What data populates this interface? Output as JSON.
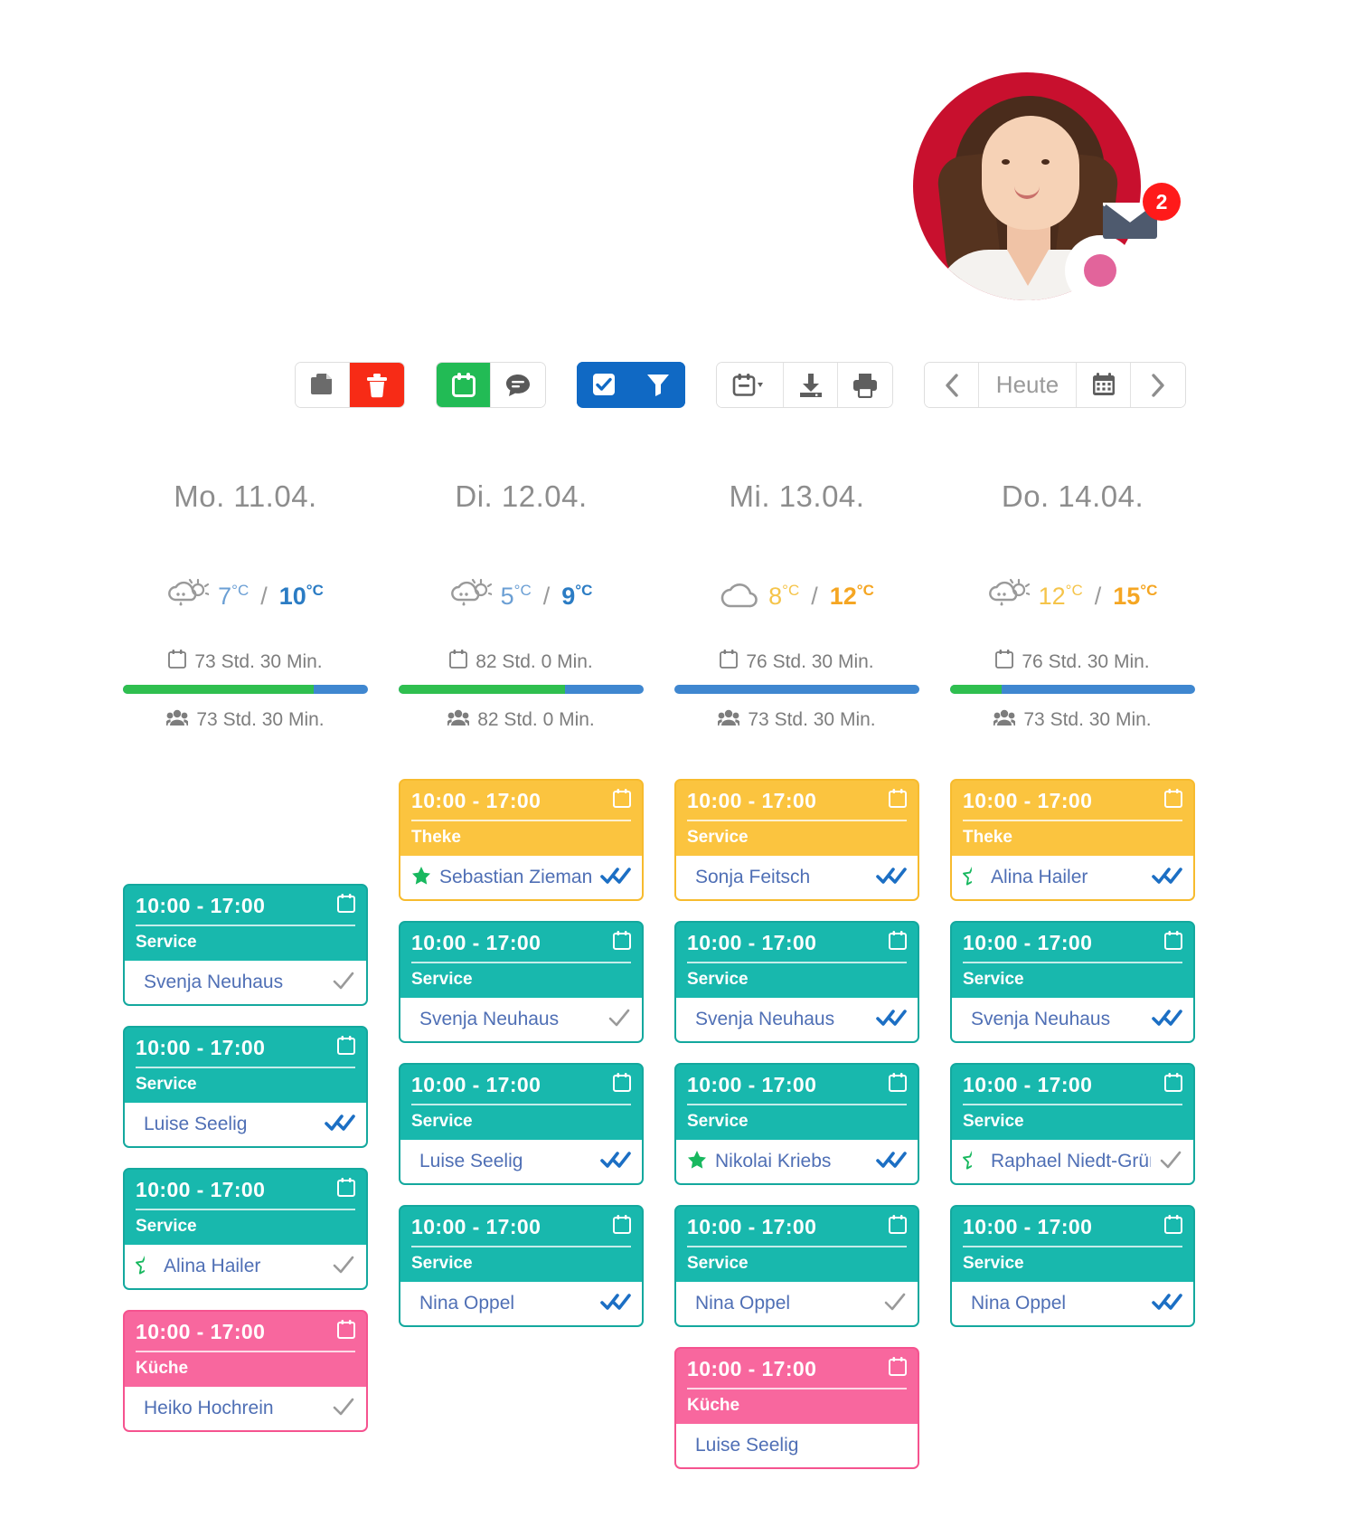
{
  "avatar": {
    "status_color": "#e2649b",
    "ring_color": "#c8102e",
    "name_alt": "user-avatar"
  },
  "mail": {
    "badge_count": "2",
    "icon": "mail-icon"
  },
  "toolbar": {
    "groups": [
      {
        "name": "edit-group",
        "buttons": [
          {
            "name": "copy-button",
            "icon": "copy-icon",
            "style": "plain"
          },
          {
            "name": "delete-button",
            "icon": "trash-icon",
            "style": "red"
          }
        ]
      },
      {
        "name": "create-group",
        "buttons": [
          {
            "name": "add-shift-button",
            "icon": "calendar-plus-icon",
            "style": "green"
          },
          {
            "name": "comment-button",
            "icon": "chat-bubble-icon",
            "style": "plain"
          }
        ]
      },
      {
        "name": "select-filter-group",
        "buttons": [
          {
            "name": "select-all-button",
            "icon": "checkbox-icon",
            "style": "blue"
          },
          {
            "name": "filter-button",
            "icon": "funnel-icon",
            "style": "blue"
          }
        ]
      },
      {
        "name": "view-export-group",
        "buttons": [
          {
            "name": "view-mode-button",
            "icon": "calendar-dropdown-icon",
            "style": "plain"
          },
          {
            "name": "download-button",
            "icon": "download-icon",
            "style": "plain"
          },
          {
            "name": "print-button",
            "icon": "printer-icon",
            "style": "plain"
          }
        ]
      },
      {
        "name": "navigation-group",
        "buttons": [
          {
            "name": "previous-period-button",
            "icon": "chevron-left-icon",
            "style": "plain"
          },
          {
            "name": "today-button",
            "icon": "",
            "style": "today"
          },
          {
            "name": "date-picker-button",
            "icon": "calendar-grid-icon",
            "style": "plain"
          },
          {
            "name": "next-period-button",
            "icon": "chevron-right-icon",
            "style": "plain"
          }
        ]
      }
    ],
    "today_label": "Heute"
  },
  "days": [
    {
      "title": "Mo. 11.04.",
      "weather": {
        "icon": "sun-rain-cloud-icon",
        "min": "7",
        "max": "10",
        "unit": "°C",
        "tone": "blue"
      },
      "planned": {
        "icon": "calendar-icon",
        "text": "73 Std. 30 Min."
      },
      "actual": {
        "icon": "people-icon",
        "text": "73 Std. 30 Min."
      },
      "progress_percent": 78,
      "lead_empty": true,
      "shifts": [
        {
          "time": "10:00 - 17:00",
          "role": "Service",
          "person": "Svenja Neuhaus",
          "type": "service",
          "person_icon": "",
          "status_icon": "single-check-gray"
        },
        {
          "time": "10:00 - 17:00",
          "role": "Service",
          "person": "Luise Seelig",
          "type": "service",
          "person_icon": "",
          "status_icon": "double-check-blue"
        },
        {
          "time": "10:00 - 17:00",
          "role": "Service",
          "person": "Alina Hailer",
          "type": "service",
          "person_icon": "half-star-icon",
          "status_icon": "single-check-gray"
        },
        {
          "time": "10:00 - 17:00",
          "role": "Küche",
          "person": "Heiko Hochrein",
          "type": "kueche",
          "person_icon": "",
          "status_icon": "single-check-gray"
        }
      ]
    },
    {
      "title": "Di. 12.04.",
      "weather": {
        "icon": "sun-rain-cloud-icon",
        "min": "5",
        "max": "9",
        "unit": "°C",
        "tone": "blue"
      },
      "planned": {
        "icon": "calendar-icon",
        "text": "82 Std. 0 Min."
      },
      "actual": {
        "icon": "people-icon",
        "text": "82 Std. 0 Min."
      },
      "progress_percent": 68,
      "lead_empty": false,
      "shifts": [
        {
          "time": "10:00 - 17:00",
          "role": "Theke",
          "person": "Sebastian Ziemann",
          "type": "theke",
          "person_icon": "full-star-icon",
          "status_icon": "double-check-blue"
        },
        {
          "time": "10:00 - 17:00",
          "role": "Service",
          "person": "Svenja Neuhaus",
          "type": "service",
          "person_icon": "",
          "status_icon": "single-check-gray"
        },
        {
          "time": "10:00 - 17:00",
          "role": "Service",
          "person": "Luise Seelig",
          "type": "service",
          "person_icon": "",
          "status_icon": "double-check-blue"
        },
        {
          "time": "10:00 - 17:00",
          "role": "Service",
          "person": "Nina Oppel",
          "type": "service",
          "person_icon": "",
          "status_icon": "double-check-blue"
        }
      ]
    },
    {
      "title": "Mi. 13.04.",
      "weather": {
        "icon": "cloud-icon",
        "min": "8",
        "max": "12",
        "unit": "°C",
        "tone": "orange"
      },
      "planned": {
        "icon": "calendar-icon",
        "text": "76 Std. 30 Min."
      },
      "actual": {
        "icon": "people-icon",
        "text": "73 Std. 30 Min."
      },
      "progress_percent": 0,
      "lead_empty": false,
      "shifts": [
        {
          "time": "10:00 - 17:00",
          "role": "Service",
          "person": "Sonja Feitsch",
          "type": "theke",
          "person_icon": "",
          "status_icon": "double-check-blue"
        },
        {
          "time": "10:00 - 17:00",
          "role": "Service",
          "person": "Svenja Neuhaus",
          "type": "service",
          "person_icon": "",
          "status_icon": "double-check-blue"
        },
        {
          "time": "10:00 - 17:00",
          "role": "Service",
          "person": "Nikolai Kriebs",
          "type": "service",
          "person_icon": "full-star-icon",
          "status_icon": "double-check-blue"
        },
        {
          "time": "10:00 - 17:00",
          "role": "Service",
          "person": "Nina Oppel",
          "type": "service",
          "person_icon": "",
          "status_icon": "single-check-gray"
        },
        {
          "time": "10:00 - 17:00",
          "role": "Küche",
          "person": "Luise Seelig",
          "type": "kueche",
          "person_icon": "",
          "status_icon": ""
        }
      ]
    },
    {
      "title": "Do. 14.04.",
      "weather": {
        "icon": "sun-rain-cloud-icon",
        "min": "12",
        "max": "15",
        "unit": "°C",
        "tone": "orange"
      },
      "planned": {
        "icon": "calendar-icon",
        "text": "76 Std. 30 Min."
      },
      "actual": {
        "icon": "people-icon",
        "text": "73 Std. 30 Min."
      },
      "progress_percent": 21,
      "lead_empty": false,
      "shifts": [
        {
          "time": "10:00 - 17:00",
          "role": "Theke",
          "person": "Alina Hailer",
          "type": "theke",
          "person_icon": "half-star-icon",
          "status_icon": "double-check-blue"
        },
        {
          "time": "10:00 - 17:00",
          "role": "Service",
          "person": "Svenja Neuhaus",
          "type": "service",
          "person_icon": "",
          "status_icon": "double-check-blue"
        },
        {
          "time": "10:00 - 17:00",
          "role": "Service",
          "person": "Raphael Niedt-Grünbauer",
          "type": "service",
          "person_icon": "half-star-icon",
          "status_icon": "single-check-gray"
        },
        {
          "time": "10:00 - 17:00",
          "role": "Service",
          "person": "Nina Oppel",
          "type": "service",
          "person_icon": "",
          "status_icon": "double-check-blue"
        }
      ]
    }
  ],
  "colors": {
    "theke": "#fbc43f",
    "service": "#18b8ad",
    "kueche": "#f8679e",
    "progress_done": "#2fbf4f",
    "progress_rest": "#3f87d0",
    "name_text": "#4f6fb5"
  }
}
